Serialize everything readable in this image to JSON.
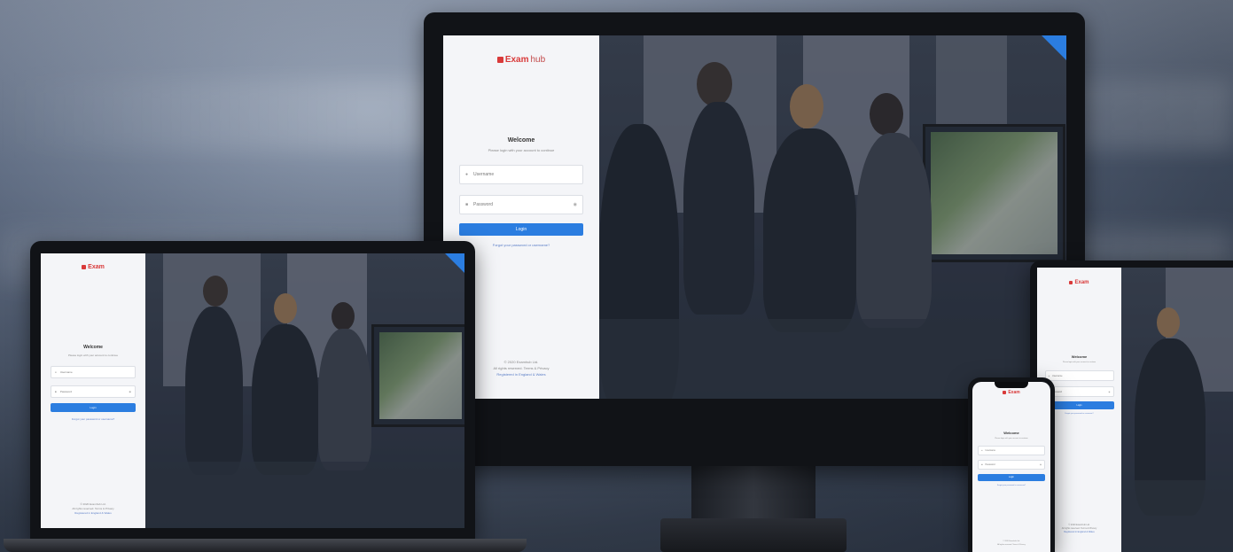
{
  "brand": {
    "logo_text": "Exam",
    "logo_tail": "hub"
  },
  "login": {
    "welcome": "Welcome",
    "subtitle": "Please login with your account to continue",
    "username_placeholder": "Username",
    "password_placeholder": "Password",
    "login_button": "Login",
    "forgot_link": "Forgot your password or username?",
    "footer_line1": "© 2020 Examhub Ltd.",
    "footer_line2": "All rights reserved. Terms & Privacy",
    "footer_line3": "Registered in England & Wales"
  },
  "icons": {
    "user": "user-icon",
    "lock": "lock-icon",
    "eye": "eye-icon"
  },
  "colors": {
    "accent": "#2b7de0",
    "brand": "#d93a3a",
    "panel": "#f4f5f8"
  }
}
